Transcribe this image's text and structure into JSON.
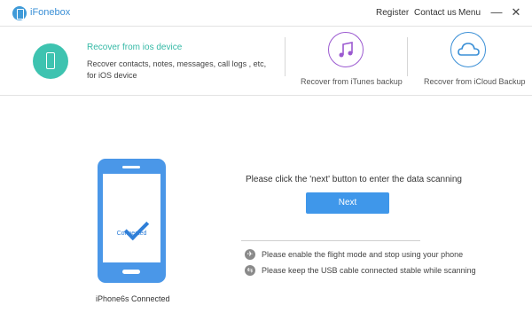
{
  "app": {
    "title": "iFonebox"
  },
  "nav": {
    "register": "Register",
    "contact": "Contact us",
    "menu": "Menu"
  },
  "window": {
    "minimize": "—",
    "close": "✕"
  },
  "modes": {
    "ios": {
      "title": "Recover from ios device",
      "description": "Recover contacts, notes, messages, call logs , etc, for iOS device",
      "icon": "phone-icon",
      "color": "#3ec3b0"
    },
    "itunes": {
      "label": "Recover from iTunes backup",
      "icon": "music-note-icon",
      "color": "#9b59d0"
    },
    "icloud": {
      "label": "Recover from iCloud Backup",
      "icon": "cloud-icon",
      "color": "#3a8fd6"
    }
  },
  "device": {
    "status": "Connected",
    "label": "iPhone6s Connected"
  },
  "scan": {
    "message": "Please click the 'next' button to enter the data scanning",
    "next_label": "Next"
  },
  "tips": [
    {
      "icon": "airplane-icon",
      "text": "Please enable the flight mode and stop using your phone"
    },
    {
      "icon": "usb-icon",
      "text": "Please keep the USB cable connected stable while scanning"
    }
  ]
}
